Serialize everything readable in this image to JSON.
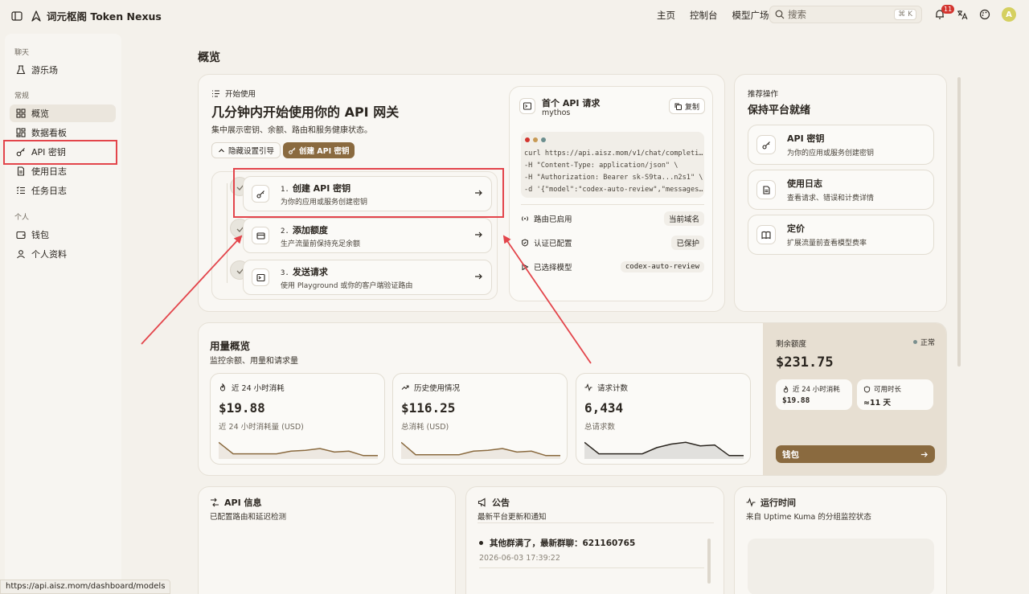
{
  "topbar": {
    "brand": "词元枢阁 Token Nexus",
    "nav": [
      "主页",
      "控制台",
      "模型广场"
    ],
    "search_placeholder": "搜索",
    "search_shortcut": "⌘ K",
    "notification_count": "11"
  },
  "sidebar": {
    "sections": [
      {
        "title": "聊天",
        "items": [
          {
            "label": "游乐场",
            "icon": "flask-icon"
          }
        ]
      },
      {
        "title": "常规",
        "items": [
          {
            "label": "概览",
            "icon": "grid-icon",
            "active": true
          },
          {
            "label": "数据看板",
            "icon": "dashboard-icon"
          },
          {
            "label": "API 密钥",
            "icon": "key-icon"
          },
          {
            "label": "使用日志",
            "icon": "document-icon"
          },
          {
            "label": "任务日志",
            "icon": "list-check-icon"
          }
        ]
      },
      {
        "title": "个人",
        "items": [
          {
            "label": "钱包",
            "icon": "wallet-icon"
          },
          {
            "label": "个人资料",
            "icon": "user-icon"
          }
        ]
      }
    ]
  },
  "page_title": "概览",
  "getting_started": {
    "kicker": "开始使用",
    "title": "几分钟内开始使用你的 API 网关",
    "subtitle": "集中展示密钥、余额、路由和服务健康状态。",
    "hide_guide_label": "隐藏设置引导",
    "create_key_label": "创建 API 密钥",
    "steps": [
      {
        "num": "1.",
        "title": "创建 API 密钥",
        "desc": "为你的应用或服务创建密钥"
      },
      {
        "num": "2.",
        "title": "添加额度",
        "desc": "生产流量前保持充足余额"
      },
      {
        "num": "3.",
        "title": "发送请求",
        "desc": "使用 Playground 或你的客户端验证路由"
      }
    ]
  },
  "first_request": {
    "title": "首个 API 请求",
    "model": "mythos",
    "copy_label": "复制",
    "code": [
      "curl https://api.aisz.mom/v1/chat/completi…",
      "-H \"Content-Type: application/json\" \\",
      "-H \"Authorization: Bearer sk-S9ta...n2s1\" \\",
      "-d '{\"model\":\"codex-auto-review\",\"messages…"
    ],
    "rows": [
      {
        "key": "路由已启用",
        "value": "当前域名"
      },
      {
        "key": "认证已配置",
        "value": "已保护"
      },
      {
        "key": "已选择模型",
        "value": "codex-auto-review"
      }
    ]
  },
  "recommended": {
    "kicker": "推荐操作",
    "title": "保持平台就绪",
    "items": [
      {
        "title": "API 密钥",
        "desc": "为你的应用或服务创建密钥"
      },
      {
        "title": "使用日志",
        "desc": "查看请求、错误和计费详情"
      },
      {
        "title": "定价",
        "desc": "扩展流量前查看模型费率"
      }
    ]
  },
  "usage": {
    "title": "用量概览",
    "subtitle": "监控余额、用量和请求量",
    "stats": [
      {
        "label": "近 24 小时消耗",
        "value": "$19.88",
        "sub": "近 24 小时消耗量 (USD)",
        "spark": [
          0.85,
          0.2,
          0.2,
          0.2,
          0.2,
          0.35,
          0.4,
          0.5,
          0.3,
          0.35,
          0.1,
          0.1
        ]
      },
      {
        "label": "历史使用情况",
        "value": "$116.25",
        "sub": "总消耗 (USD)",
        "spark": [
          0.85,
          0.15,
          0.15,
          0.15,
          0.15,
          0.35,
          0.4,
          0.5,
          0.3,
          0.35,
          0.1,
          0.1
        ]
      },
      {
        "label": "请求计数",
        "value": "6,434",
        "sub": "总请求数",
        "spark": [
          0.85,
          0.2,
          0.2,
          0.2,
          0.2,
          0.55,
          0.75,
          0.85,
          0.65,
          0.7,
          0.1,
          0.1
        ]
      }
    ],
    "balance": {
      "label": "剩余额度",
      "status": "正常",
      "value": "$231.75",
      "mini": [
        {
          "label": "近 24 小时消耗",
          "value": "$19.88"
        },
        {
          "label": "可用时长",
          "value": "≈11 天"
        }
      ],
      "wallet_label": "钱包"
    }
  },
  "api_info": {
    "title": "API 信息",
    "subtitle": "已配置路由和延迟检测"
  },
  "announcements": {
    "title": "公告",
    "subtitle": "最新平台更新和通知",
    "items": [
      {
        "text": "其他群满了，最新群聊：621160765",
        "date": "2026-06-03 17:39:22"
      }
    ]
  },
  "uptime": {
    "title": "运行时间",
    "subtitle": "来自 Uptime Kuma 的分组监控状态"
  },
  "status_url": "https://api.aisz.mom/dashboard/models",
  "colors": {
    "accent": "#8a6a3f",
    "background": "#f4f1eb",
    "annotation": "#e3454b"
  }
}
